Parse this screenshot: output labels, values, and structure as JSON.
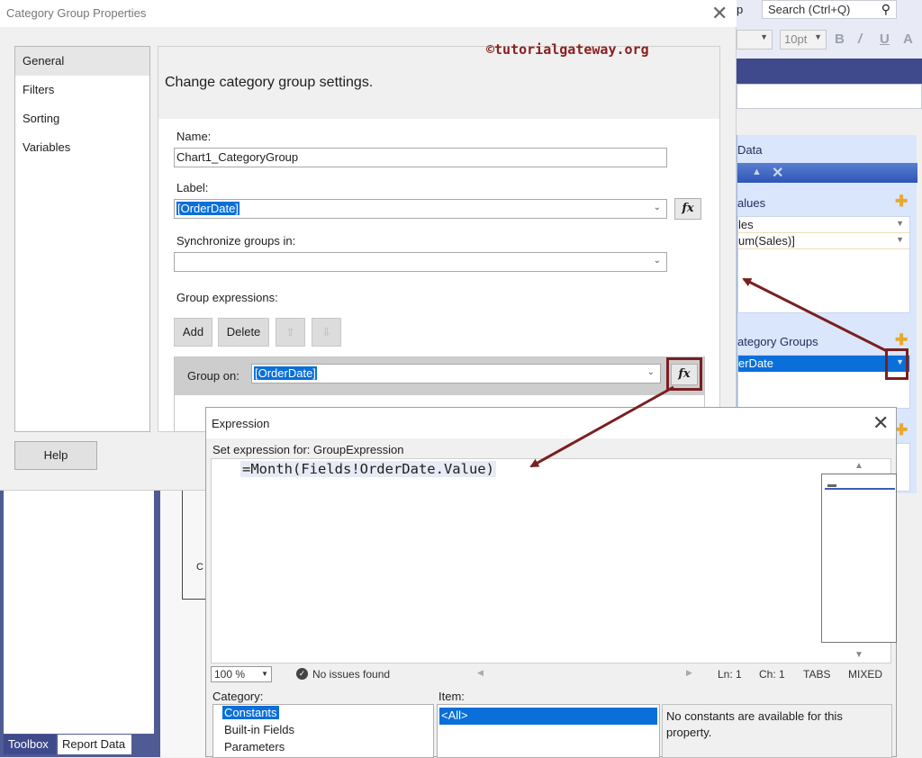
{
  "background": {
    "search_placeholder": "Search (Ctrl+Q)",
    "help_menu_fragment": "p",
    "font_size": "10pt",
    "format_buttons": [
      "B",
      "/",
      "U",
      "A"
    ],
    "toolbox_tab": "Toolbox",
    "report_data_tab": "Report Data",
    "design_fragment": "C",
    "chart_data": {
      "title": "Data",
      "values_header": "alues",
      "value_rows": [
        "les",
        "um(Sales)]"
      ],
      "category_groups_header": "ategory Groups",
      "category_group_row": "erDate"
    }
  },
  "watermark": "©tutorialgateway.org",
  "category_group_dialog": {
    "title": "Category Group Properties",
    "nav_items": [
      "General",
      "Filters",
      "Sorting",
      "Variables"
    ],
    "active_nav": "General",
    "heading": "Change category group settings.",
    "name_label": "Name:",
    "name_value": "Chart1_CategoryGroup",
    "label_label": "Label:",
    "label_value": "[OrderDate]",
    "sync_label": "Synchronize groups in:",
    "sync_value": "",
    "group_expr_label": "Group expressions:",
    "add_label": "Add",
    "delete_label": "Delete",
    "group_on_label": "Group on:",
    "group_on_value": "[OrderDate]",
    "help_label": "Help",
    "fx_label": "fx"
  },
  "expression_dialog": {
    "title": "Expression",
    "set_for": "Set expression for: GroupExpression",
    "expression": "=Month(Fields!OrderDate.Value)",
    "zoom": "100 %",
    "issues": "No issues found",
    "line": "Ln: 1",
    "col": "Ch: 1",
    "tabs": "TABS",
    "mode": "MIXED",
    "category_label": "Category:",
    "categories": [
      "Constants",
      "Built-in Fields",
      "Parameters"
    ],
    "selected_category": "Constants",
    "item_label": "Item:",
    "items": [
      "<All>"
    ],
    "selected_item": "<All>",
    "description": "No constants are available for this property."
  },
  "colors": {
    "accent_blue": "#0a6fd8",
    "annotation_red": "#7a1f1f",
    "vs_navy": "#3f4a8c"
  }
}
